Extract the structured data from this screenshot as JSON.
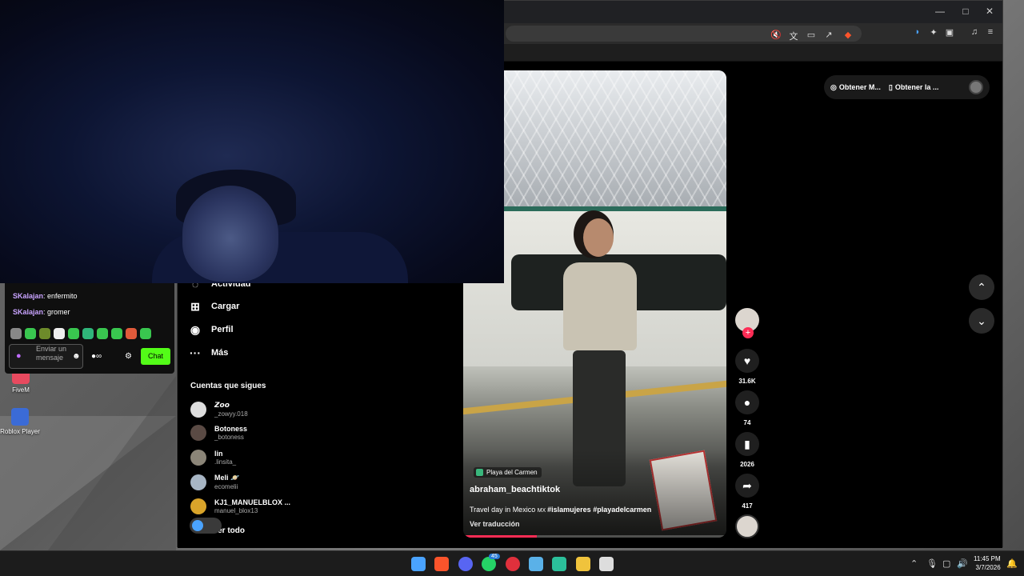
{
  "desktop": {
    "icons": [
      {
        "label": "FiveM",
        "color": "#e84a5f"
      },
      {
        "label": "Roblox Player",
        "color": "#3b6bd6"
      }
    ]
  },
  "browser": {
    "window_controls": [
      "—",
      "□",
      "✕"
    ],
    "toolbar_icons": [
      "mute-icon",
      "translate-icon",
      "cast-icon",
      "share-icon",
      "brave-shield-icon",
      "audio-icon",
      "extensions-icon",
      "sidebar-icon",
      "music-icon",
      "menu-icon"
    ]
  },
  "tiktok": {
    "nav": [
      {
        "label": "Actividad",
        "icon": "◌"
      },
      {
        "label": "Cargar",
        "icon": "⊞"
      },
      {
        "label": "Perfil",
        "icon": "◉"
      },
      {
        "label": "Más",
        "icon": "···"
      }
    ],
    "following_title": "Cuentas que sigues",
    "following": [
      {
        "name": "𝙕𝙤𝙤",
        "handle": "_zowyy.018"
      },
      {
        "name": "Botoness",
        "handle": "_botoness"
      },
      {
        "name": "lin",
        "handle": ".linsita_"
      },
      {
        "name": "Meli 🪐",
        "handle": "ecomelii"
      },
      {
        "name": "KJ1_MANUELBLOX ...",
        "handle": "manuel_blox13"
      }
    ],
    "see_all": "Ver todo",
    "topbar": {
      "get_app_1": "Obtener M...",
      "get_app_2": "Obtener la ..."
    },
    "video": {
      "location": "Playa del Carmen",
      "username": "abraham_beachtiktok",
      "caption_text": "Travel day in Mexico ",
      "caption_flag": "MX ",
      "caption_tags": "#islamujeres #playadelcarmen",
      "translate": "Ver traducción",
      "progress": 0.28
    },
    "actions": {
      "likes": "31.6K",
      "comments": "74",
      "saves": "2026",
      "shares": "417"
    }
  },
  "chat": {
    "messages": [
      {
        "user": "SKalajan",
        "text": "enfermito"
      },
      {
        "user": "SKalajan",
        "text": "gromer"
      }
    ],
    "input_placeholder": "Enviar un mensaje",
    "points": "∞",
    "send_label": "Chat",
    "accent": "#53fc18"
  },
  "taskbar": {
    "apps": [
      "windows-start-icon",
      "brave-icon",
      "discord-icon",
      "whatsapp-icon",
      "youtube-icon",
      "notepad-icon",
      "tiktok-icon",
      "explorer-icon",
      "app-icon"
    ],
    "whatsapp_badge": "45",
    "time": "11:45 PM",
    "date": "3/7/2026"
  }
}
